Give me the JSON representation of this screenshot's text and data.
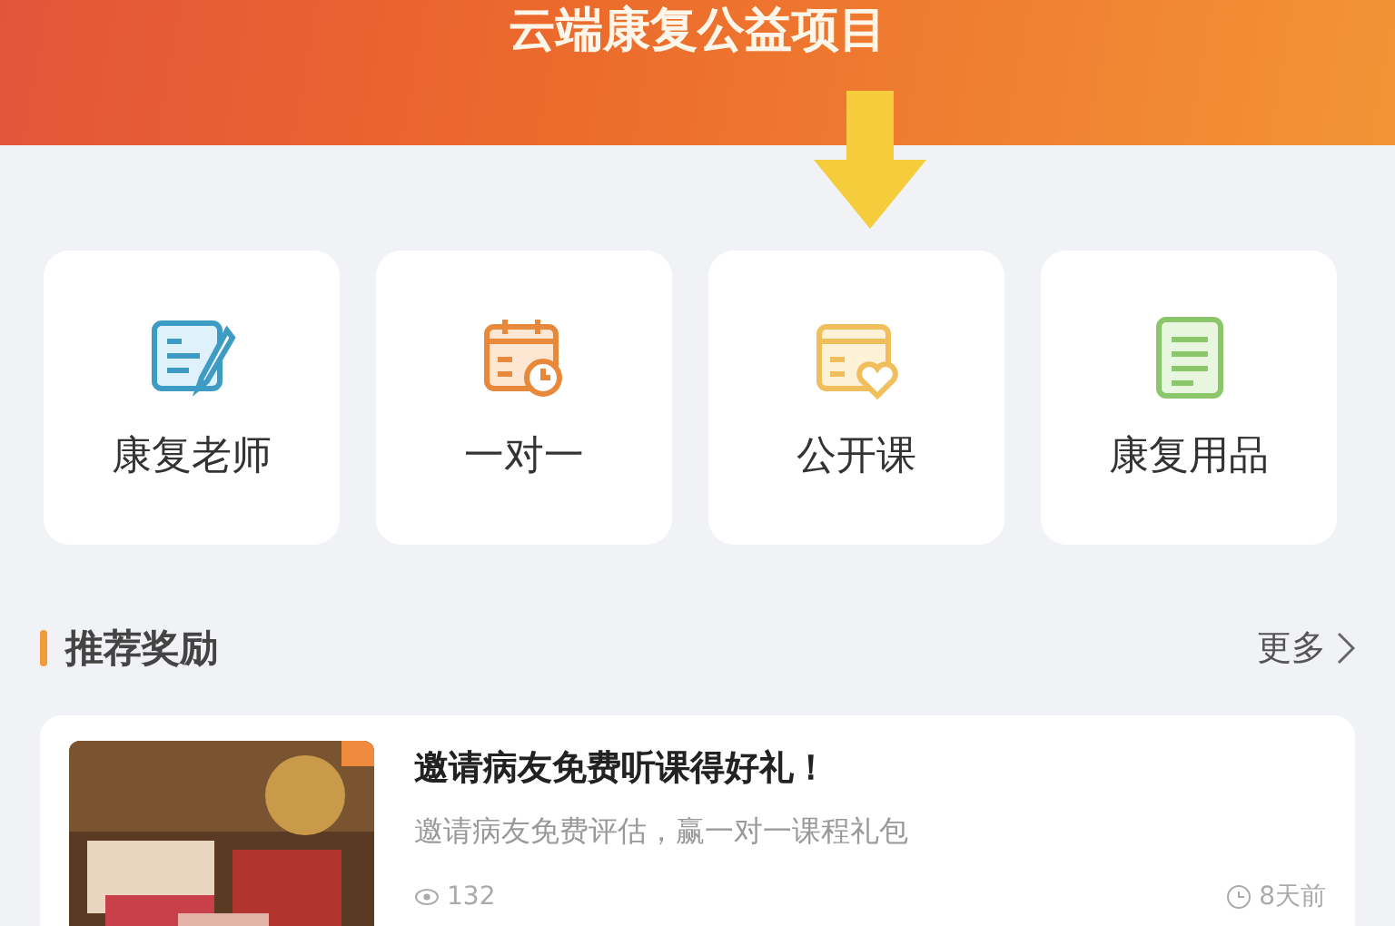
{
  "banner": {
    "title": "云端康复公益项目"
  },
  "services": [
    {
      "kind": "teacher",
      "label": "康复老师"
    },
    {
      "kind": "calendar",
      "label": "一对一"
    },
    {
      "kind": "course",
      "label": "公开课"
    },
    {
      "kind": "supplies",
      "label": "康复用品"
    }
  ],
  "rewards": {
    "title": "推荐奖励",
    "more": "更多",
    "items": [
      {
        "kind": "picture",
        "title": "邀请病友免费听课得好礼！",
        "description": "邀请病友免费评估，赢一对一课程礼包",
        "views": "132",
        "time": "8天前"
      }
    ]
  }
}
